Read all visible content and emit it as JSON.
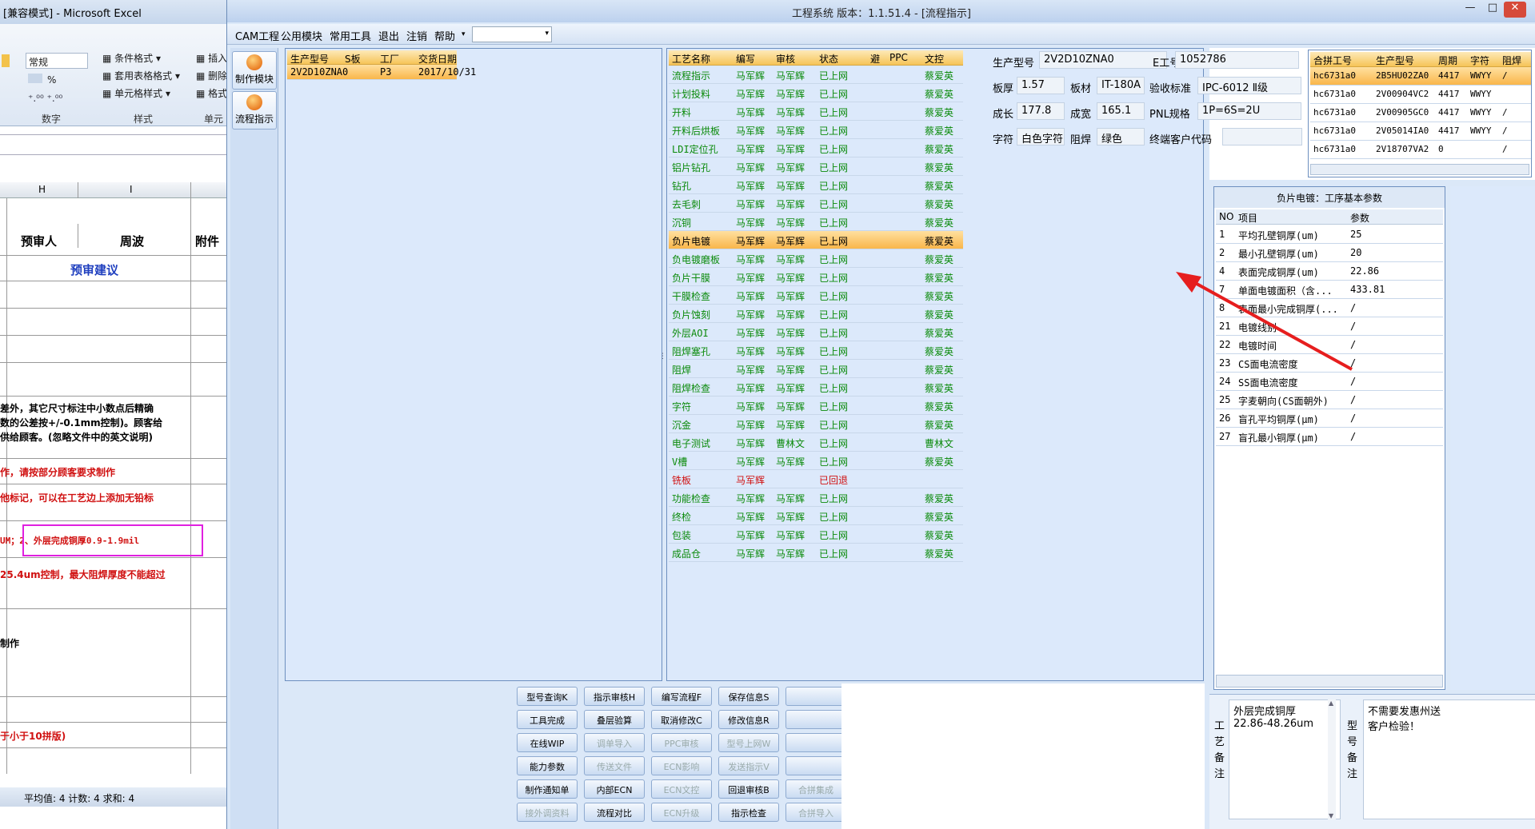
{
  "excel": {
    "title": "[兼容模式] - Microsoft Excel",
    "number_format": "常规",
    "ribbon": {
      "conditional_format": "条件格式",
      "table_format": "套用表格格式",
      "cell_style": "单元格样式",
      "insert": "插入",
      "delete": "删除",
      "format": "格式",
      "group_number": "数字",
      "group_style": "样式",
      "group_cell": "单元",
      "percent": "%"
    },
    "col_headers": [
      "H",
      "I"
    ],
    "rows": [
      "预审人",
      "周波",
      "附件",
      "预审建议",
      "差外，其它尺寸标注中小数点后精确",
      "数的公差按+/-0.1mm控制)。顾客给",
      "供给顾客。(忽略文件中的英文说明)",
      "作，请按部分顾客要求制作",
      "他标记，可以在工艺边上添加无铅标",
      "UM；2、外层完成铜厚0.9-1.9mil",
      "25.4um控制，最大阻焊厚度不能超过",
      "制作",
      "于小于10拼版)"
    ],
    "status": "平均值: 4   计数: 4   求和: 4"
  },
  "app": {
    "title": "工程系统    版本：1.1.51.4 - [流程指示]",
    "window_buttons": [
      "—",
      "□",
      "✕"
    ],
    "menu": [
      "CAM工程",
      "公用模块",
      "常用工具",
      "退出",
      "注销",
      "帮助"
    ],
    "left_tools": [
      "制作模块",
      "流程指示"
    ],
    "order_table": {
      "headers": [
        "生产型号",
        "S板",
        "工厂",
        "交货日期"
      ],
      "rows": [
        [
          "2V2D10ZNA0",
          "",
          "P3",
          "2017/10/31"
        ]
      ]
    },
    "process_table": {
      "headers": [
        "工艺名称",
        "编写",
        "审核",
        "状态",
        "避",
        "PPC",
        "文控"
      ],
      "rows": [
        [
          "流程指示",
          "马军辉",
          "马军辉",
          "已上网",
          "",
          "",
          "蔡爱英"
        ],
        [
          "计划投料",
          "马军辉",
          "马军辉",
          "已上网",
          "",
          "",
          "蔡爱英"
        ],
        [
          "开料",
          "马军辉",
          "马军辉",
          "已上网",
          "",
          "",
          "蔡爱英"
        ],
        [
          "开料后烘板",
          "马军辉",
          "马军辉",
          "已上网",
          "",
          "",
          "蔡爱英"
        ],
        [
          "LDI定位孔",
          "马军辉",
          "马军辉",
          "已上网",
          "",
          "",
          "蔡爱英"
        ],
        [
          "铝片钻孔",
          "马军辉",
          "马军辉",
          "已上网",
          "",
          "",
          "蔡爱英"
        ],
        [
          "钻孔",
          "马军辉",
          "马军辉",
          "已上网",
          "",
          "",
          "蔡爱英"
        ],
        [
          "去毛刺",
          "马军辉",
          "马军辉",
          "已上网",
          "",
          "",
          "蔡爱英"
        ],
        [
          "沉铜",
          "马军辉",
          "马军辉",
          "已上网",
          "",
          "",
          "蔡爱英"
        ],
        [
          "负片电镀",
          "马军辉",
          "马军辉",
          "已上网",
          "",
          "",
          "蔡爱英"
        ],
        [
          "负电镀磨板",
          "马军辉",
          "马军辉",
          "已上网",
          "",
          "",
          "蔡爱英"
        ],
        [
          "负片干膜",
          "马军辉",
          "马军辉",
          "已上网",
          "",
          "",
          "蔡爱英"
        ],
        [
          "干膜检查",
          "马军辉",
          "马军辉",
          "已上网",
          "",
          "",
          "蔡爱英"
        ],
        [
          "负片蚀刻",
          "马军辉",
          "马军辉",
          "已上网",
          "",
          "",
          "蔡爱英"
        ],
        [
          "外层AOI",
          "马军辉",
          "马军辉",
          "已上网",
          "",
          "",
          "蔡爱英"
        ],
        [
          "阻焊塞孔",
          "马军辉",
          "马军辉",
          "已上网",
          "",
          "",
          "蔡爱英"
        ],
        [
          "阻焊",
          "马军辉",
          "马军辉",
          "已上网",
          "",
          "",
          "蔡爱英"
        ],
        [
          "阻焊检查",
          "马军辉",
          "马军辉",
          "已上网",
          "",
          "",
          "蔡爱英"
        ],
        [
          "字符",
          "马军辉",
          "马军辉",
          "已上网",
          "",
          "",
          "蔡爱英"
        ],
        [
          "沉金",
          "马军辉",
          "马军辉",
          "已上网",
          "",
          "",
          "蔡爱英"
        ],
        [
          "电子测试",
          "马军辉",
          "曹林文",
          "已上网",
          "",
          "",
          "曹林文"
        ],
        [
          "V槽",
          "马军辉",
          "马军辉",
          "已上网",
          "",
          "",
          "蔡爱英"
        ],
        [
          "铣板",
          "马军辉",
          "",
          "已回退",
          "",
          "",
          ""
        ],
        [
          "功能检查",
          "马军辉",
          "马军辉",
          "已上网",
          "",
          "",
          "蔡爱英"
        ],
        [
          "终检",
          "马军辉",
          "马军辉",
          "已上网",
          "",
          "",
          "蔡爱英"
        ],
        [
          "包装",
          "马军辉",
          "马军辉",
          "已上网",
          "",
          "",
          "蔡爱英"
        ],
        [
          "成品仓",
          "马军辉",
          "马军辉",
          "已上网",
          "",
          "",
          "蔡爱英"
        ]
      ]
    },
    "info": {
      "model_label": "生产型号",
      "model": "2V2D10ZNA0",
      "eno_label": "E工号",
      "eno": "1052786",
      "thick_label": "板厚",
      "thick": "1.57",
      "mat_label": "板材",
      "mat": "IT-180A",
      "std_label": "验收标准",
      "std": "IPC-6012 Ⅱ级",
      "len_label": "成长",
      "len": "177.8",
      "wid_label": "成宽",
      "wid": "165.1",
      "pnl_label": "PNL规格",
      "pnl": "1P=6S=2U",
      "char_label": "字符",
      "char": "白色字符",
      "mask_label": "阻焊",
      "mask": "绿色",
      "cust_label": "终端客户代码",
      "cust": ""
    },
    "combine_table": {
      "headers": [
        "合拼工号",
        "生产型号",
        "周期",
        "字符",
        "阻焊"
      ],
      "rows": [
        [
          "hc6731a0",
          "2B5HU02ZA0",
          "4417",
          "WWYY",
          "/"
        ],
        [
          "hc6731a0",
          "2V00904VC2",
          "4417",
          "WWYY",
          ""
        ],
        [
          "hc6731a0",
          "2V00905GC0",
          "4417",
          "WWYY",
          "/"
        ],
        [
          "hc6731a0",
          "2V05014IA0",
          "4417",
          "WWYY",
          "/"
        ],
        [
          "hc6731a0",
          "2V18707VA2",
          "0",
          "",
          "/"
        ]
      ]
    },
    "params": {
      "title": "负片电镀：工序基本参数",
      "headers": [
        "NO",
        "项目",
        "参数"
      ],
      "rows": [
        [
          "1",
          "平均孔壁铜厚(um)",
          "25"
        ],
        [
          "2",
          "最小孔壁铜厚(um)",
          "20"
        ],
        [
          "4",
          "表面完成铜厚(um)",
          "22.86"
        ],
        [
          "7",
          "单面电镀面积（含...",
          "433.81"
        ],
        [
          "8",
          "表面最小完成铜厚(...",
          "/"
        ],
        [
          "21",
          "电镀线别",
          "/"
        ],
        [
          "22",
          "电镀时间",
          "/"
        ],
        [
          "23",
          "CS面电流密度",
          "/"
        ],
        [
          "24",
          "SS面电流密度",
          "/"
        ],
        [
          "25",
          "字麦朝向(CS面朝外)",
          "/"
        ],
        [
          "26",
          "盲孔平均铜厚(μm)",
          "/"
        ],
        [
          "27",
          "盲孔最小铜厚(μm)",
          "/"
        ]
      ]
    },
    "remarks": {
      "process_label": "工艺备注",
      "process_text": "外层完成铜厚\n22.86-48.26um",
      "model_label": "型号备注",
      "model_text": "不需要发惠州送\n客户检验！"
    },
    "buttons": [
      [
        "型号查询K",
        "指示审核H",
        "编写流程F",
        "保存信息S",
        ""
      ],
      [
        "工具完成",
        "叠层验算",
        "取消修改C",
        "修改信息R",
        ""
      ],
      [
        "在线WIP",
        "调单导入",
        "PPC审核",
        "型号上网W",
        ""
      ],
      [
        "能力参数",
        "传送文件",
        "ECN影响",
        "发送指示V",
        ""
      ],
      [
        "制作通知单",
        "内部ECN",
        "ECN文控",
        "回退审核B",
        "合拼集成"
      ],
      [
        "接外调资料",
        "流程对比",
        "ECN升级",
        "指示检查",
        "合拼导入"
      ]
    ],
    "disabled_buttons": [
      "调单导入",
      "PPC审核",
      "型号上网W",
      "传送文件",
      "ECN影响",
      "发送指示V",
      "ECN文控",
      "合拼集成",
      "接外调资料",
      "ECN升级",
      "合拼导入"
    ]
  }
}
